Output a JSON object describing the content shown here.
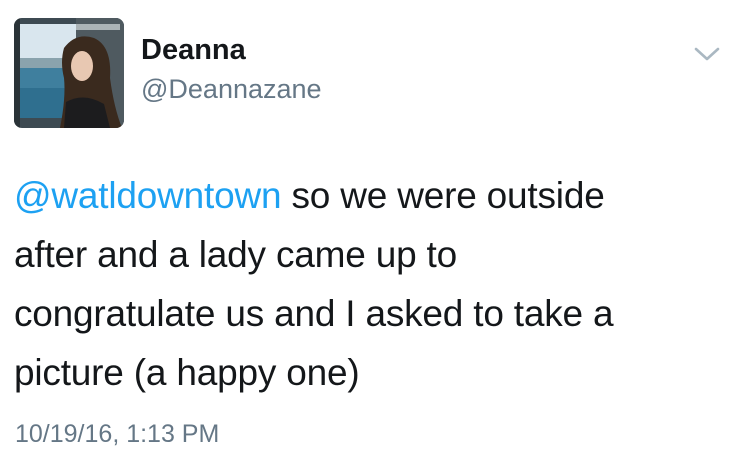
{
  "user": {
    "name": "Deanna",
    "handle": "@Deannazane"
  },
  "tweet": {
    "mention": "@watldowntown",
    "line1_rest": " so we were outside",
    "line2": "after and a lady came up to",
    "line3": "congratulate us and I asked to take a",
    "line4": "picture (a happy one)",
    "timestamp": "10/19/16, 1:13 PM"
  },
  "colors": {
    "mention": "#1da1f2",
    "secondary_text": "#657786",
    "primary_text": "#14171a"
  },
  "icons": {
    "menu": "chevron-down-icon"
  }
}
